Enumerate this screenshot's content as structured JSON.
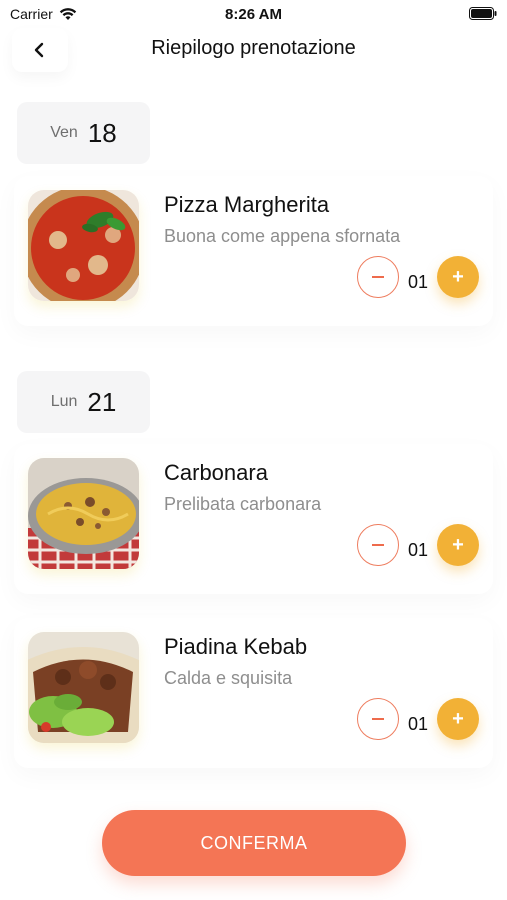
{
  "status": {
    "carrier": "Carrier",
    "time": "8:26 AM"
  },
  "nav": {
    "title": "Riepilogo prenotazione"
  },
  "days": [
    {
      "dow": "Ven",
      "day": "18",
      "items": [
        {
          "name": "Pizza Margherita",
          "desc": "Buona come appena sfornata",
          "qty": "01"
        }
      ]
    },
    {
      "dow": "Lun",
      "day": "21",
      "items": [
        {
          "name": "Carbonara",
          "desc": "Prelibata carbonara",
          "qty": "01"
        },
        {
          "name": "Piadina Kebab",
          "desc": "Calda e squisita",
          "qty": "01"
        }
      ]
    }
  ],
  "confirm_label": "CONFERMA",
  "colors": {
    "accent_orange": "#f47555",
    "plus_yellow": "#f2b136",
    "minus_border": "#ee7d5f"
  }
}
